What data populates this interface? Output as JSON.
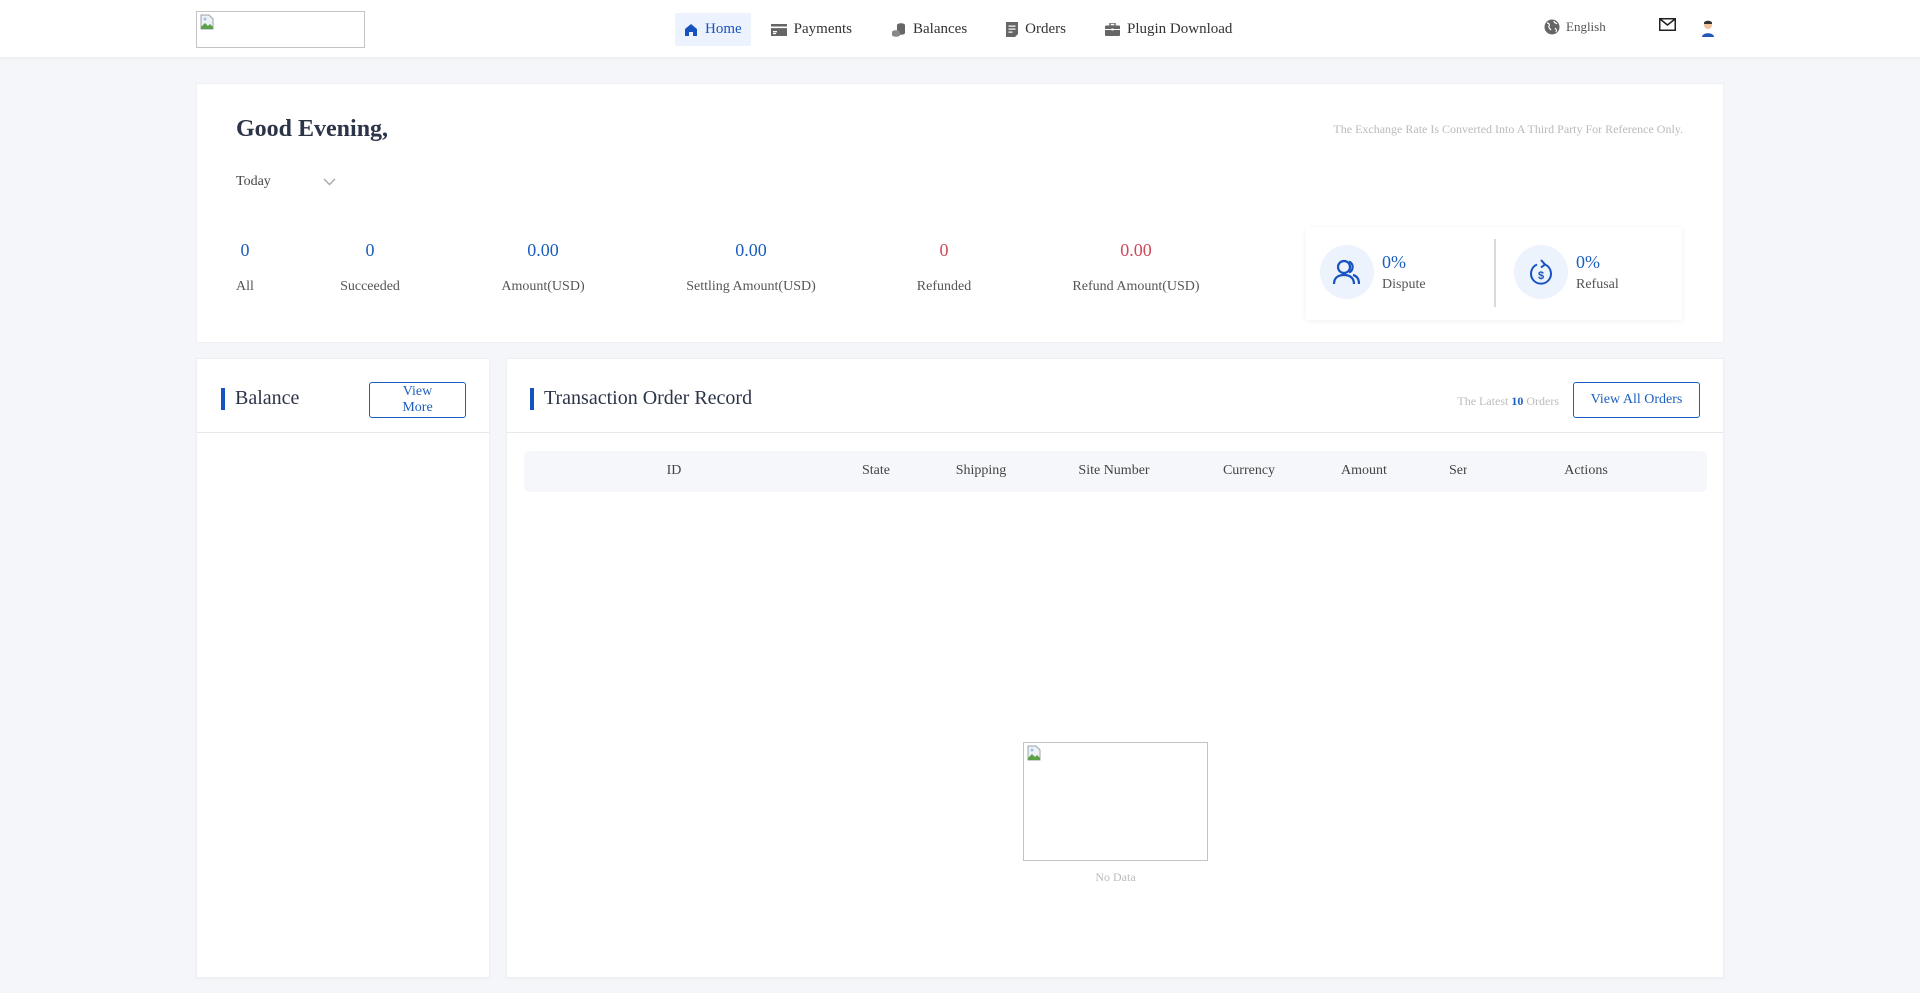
{
  "header": {
    "logo_alt": "",
    "nav": [
      {
        "label": "Home",
        "icon": "home-icon",
        "active": true
      },
      {
        "label": "Payments",
        "icon": "card-icon",
        "active": false
      },
      {
        "label": "Balances",
        "icon": "coins-icon",
        "active": false
      },
      {
        "label": "Orders",
        "icon": "document-icon",
        "active": false
      },
      {
        "label": "Plugin Download",
        "icon": "briefcase-icon",
        "active": false
      }
    ],
    "language": "English",
    "mail_icon": "mail-icon",
    "avatar_icon": "user-avatar-icon"
  },
  "summary": {
    "greeting": "Good Evening,",
    "rate_note": "The Exchange Rate Is Converted Into A Third Party For Reference Only.",
    "period": "Today",
    "stats": [
      {
        "value": "0",
        "label": "All",
        "color": "#1c5fbf"
      },
      {
        "value": "0",
        "label": "Succeeded",
        "color": "#1c5fbf"
      },
      {
        "value": "0.00",
        "label": "Amount(USD)",
        "color": "#1c5fbf"
      },
      {
        "value": "0.00",
        "label": "Settling Amount(USD)",
        "color": "#1c5fbf"
      },
      {
        "value": "0",
        "label": "Refunded",
        "color": "#cf4a58"
      },
      {
        "value": "0.00",
        "label": "Refund Amount(USD)",
        "color": "#cf4a58"
      }
    ],
    "rates": [
      {
        "value": "0%",
        "label": "Dispute",
        "icon": "users-icon"
      },
      {
        "value": "0%",
        "label": "Refusal",
        "icon": "refund-dollar-icon"
      }
    ]
  },
  "balance": {
    "title": "Balance",
    "view_more": "View More"
  },
  "orders": {
    "title": "Transaction Order Record",
    "latest_prefix": "The Latest ",
    "latest_count": "10",
    "latest_suffix": " Orders",
    "view_all": "View All Orders",
    "columns": [
      "ID",
      "State",
      "Shipping",
      "Site Number",
      "Currency",
      "Amount",
      "Ser",
      "Actions"
    ],
    "empty_text": "No Data"
  },
  "colors": {
    "accent": "#1652c0",
    "stat_blue": "#1c5fbf",
    "stat_red": "#cf4a58"
  }
}
